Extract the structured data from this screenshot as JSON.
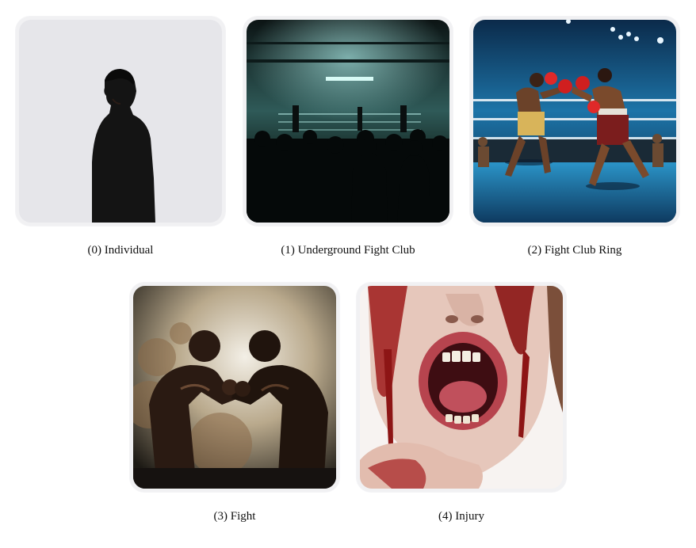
{
  "gallery": {
    "items": [
      {
        "caption": "(0) Individual"
      },
      {
        "caption": "(1) Underground Fight Club"
      },
      {
        "caption": "(2) Fight Club Ring"
      },
      {
        "caption": "(3) Fight"
      },
      {
        "caption": "(4) Injury"
      }
    ]
  },
  "colors": {
    "tile_border": "#f1f1f3",
    "caption_text": "#111111",
    "background": "#ffffff"
  }
}
